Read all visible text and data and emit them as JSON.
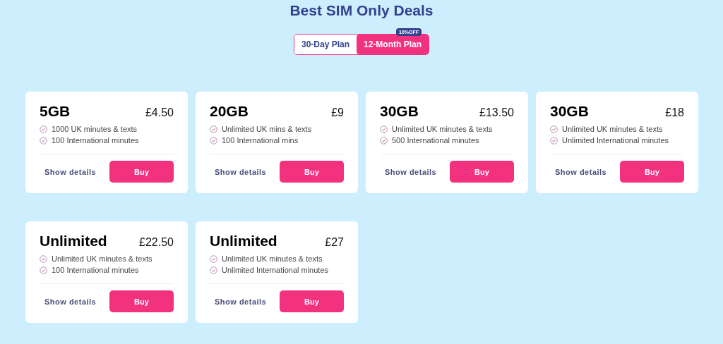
{
  "title": "Best SIM Only Deals",
  "plan_tabs": [
    {
      "label": "30-Day Plan",
      "selected": false
    },
    {
      "label": "12-Month Plan",
      "selected": true,
      "badge": "10%OFF"
    }
  ],
  "deals": [
    {
      "data": "5GB",
      "price": "£4.50",
      "features": [
        "1000 UK minutes & texts",
        "100 International minutes"
      ],
      "details_link": "Show details",
      "buy_button": "Buy"
    },
    {
      "data": "20GB",
      "price": "£9",
      "features": [
        "Unlimited UK mins & texts",
        "100 International mins"
      ],
      "details_link": "Show details",
      "buy_button": "Buy"
    },
    {
      "data": "30GB",
      "price": "£13.50",
      "features": [
        "Unlimited UK minutes & texts",
        "500 International minutes"
      ],
      "details_link": "Show details",
      "buy_button": "Buy"
    },
    {
      "data": "30GB",
      "price": "£18",
      "features": [
        "Unlimited UK minutes & texts",
        "Unlimited International minutes"
      ],
      "details_link": "Show details",
      "buy_button": "Buy"
    },
    {
      "data": "Unlimited",
      "price": "£22.50",
      "features": [
        "Unlimited UK minutes & texts",
        "100 International minutes"
      ],
      "details_link": "Show details",
      "buy_button": "Buy"
    },
    {
      "data": "Unlimited",
      "price": "£27",
      "features": [
        "Unlimited UK minutes & texts",
        "Unlimited International minutes"
      ],
      "details_link": "Show details",
      "buy_button": "Buy"
    }
  ]
}
